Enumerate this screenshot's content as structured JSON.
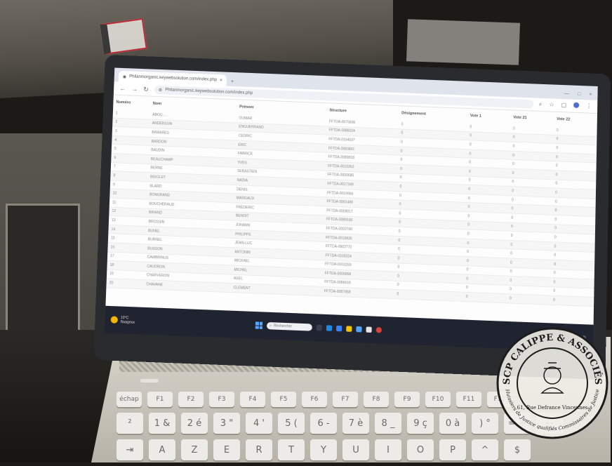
{
  "browser": {
    "tab_title": "Philanmorganic.keywebsolution.com/index.php",
    "address": "Philanmorganic.keywebsolution.com/index.php",
    "tab_close": "×",
    "new_tab": "+",
    "controls": [
      "—",
      "□",
      "×"
    ]
  },
  "table": {
    "headers": [
      "Numéro",
      "Nom",
      "Prénom",
      "Structure",
      "Désignement",
      "Vote 1",
      "Vote 21",
      "Vote 22"
    ],
    "rows": [
      [
        "1",
        "ABOU-…",
        "OUMAR",
        "FFTDA-0075836",
        "0",
        "0",
        "0",
        "0"
      ],
      [
        "2",
        "ANDERSON",
        "ENGUERRAND",
        "FFTDA-0088324",
        "0",
        "0",
        "0",
        "0"
      ],
      [
        "3",
        "BAMARES",
        "CEDRIC",
        "FFTDA-0104537",
        "0",
        "0",
        "0",
        "0"
      ],
      [
        "4",
        "BARDON",
        "ERIC",
        "FFTDA-0083801",
        "0",
        "0",
        "0",
        "0"
      ],
      [
        "5",
        "BAUDIN",
        "FABRICE",
        "FFTDA-0089818",
        "0",
        "0",
        "0",
        "0"
      ],
      [
        "6",
        "BEAUCHAMP",
        "YVES",
        "FFTDA-0010263",
        "0",
        "0",
        "0",
        "0"
      ],
      [
        "7",
        "BERNE",
        "SEBASTIEN",
        "FFTDA-0000686",
        "0",
        "0",
        "0",
        "0"
      ],
      [
        "8",
        "BIGOLET",
        "NADIA",
        "FFTDA-0017349",
        "0",
        "0",
        "0",
        "0"
      ],
      [
        "9",
        "BLARD",
        "DENIS",
        "FFTDA-0010666",
        "0",
        "0",
        "0",
        "0"
      ],
      [
        "10",
        "BONGRAND",
        "MARGAUX",
        "FFTDA-0001466",
        "0",
        "0",
        "0",
        "0"
      ],
      [
        "11",
        "BOUCHERAUD",
        "FREDERIC",
        "FFTDA-0009017",
        "0",
        "0",
        "0",
        "0"
      ],
      [
        "12",
        "BRIAND",
        "BENOIT",
        "FFTDA-0089156",
        "0",
        "0",
        "0",
        "0"
      ],
      [
        "13",
        "BROSSIN",
        "JOHANN",
        "FFTDA-0002790",
        "0",
        "0",
        "0",
        "0"
      ],
      [
        "14",
        "BUNEL",
        "PHILIPPE",
        "FFTDA-0019936",
        "0",
        "0",
        "0",
        "0"
      ],
      [
        "15",
        "BURNEL",
        "JEAN-LUC",
        "FFTDA-0002770",
        "0",
        "0",
        "0",
        "0"
      ],
      [
        "16",
        "BUSSON",
        "ANTONIN",
        "FFTDA-0108324",
        "0",
        "0",
        "0",
        "0"
      ],
      [
        "17",
        "CAMBRINUS",
        "MICKAEL",
        "FFTDA-0003259",
        "0",
        "0",
        "0",
        "0"
      ],
      [
        "18",
        "CAUDRON",
        "MICHEL",
        "FFTDA-0005858",
        "0",
        "0",
        "0",
        "0"
      ],
      [
        "19",
        "CHARVERON",
        "AXEL",
        "FFTDA-0086616",
        "0",
        "0",
        "0",
        "0"
      ],
      [
        "20",
        "CHAVANE",
        "CLEMENT",
        "FFTDA-0087458",
        "0",
        "0",
        "0",
        "0"
      ]
    ]
  },
  "taskbar": {
    "weather_temp": "10°C",
    "weather_desc": "Nuageux",
    "search_placeholder": "Rechercher",
    "tray_text": "^ ⌂ 🔊"
  },
  "keyboard": {
    "row1": [
      "échap",
      "F1",
      "F2",
      "F3",
      "F4",
      "F5",
      "F6",
      "F7",
      "F8",
      "F9",
      "F10",
      "F11",
      "F12"
    ],
    "row2": [
      "²",
      "1 &",
      "2 é",
      "3 \"",
      "4 '",
      "5 (",
      "6 -",
      "7 è",
      "8 _",
      "9 ç",
      "0 à",
      ") °",
      "= +",
      "←"
    ],
    "row3": [
      "⇥",
      "A",
      "Z",
      "E",
      "R",
      "T",
      "Y",
      "U",
      "I",
      "O",
      "P",
      "^",
      "$"
    ]
  },
  "stamp": {
    "text_top": "SCP CALIPPE & ASSOCIÉS",
    "text_bottom": "Huissiers de Justice qualifiés Commissaires de Justice",
    "address": "61, Rue Defrance Vincennes"
  },
  "colors": {
    "screen_bg": "#fdfdfd",
    "taskbar": "#202431",
    "stamp_ink": "#1c1c1c"
  }
}
